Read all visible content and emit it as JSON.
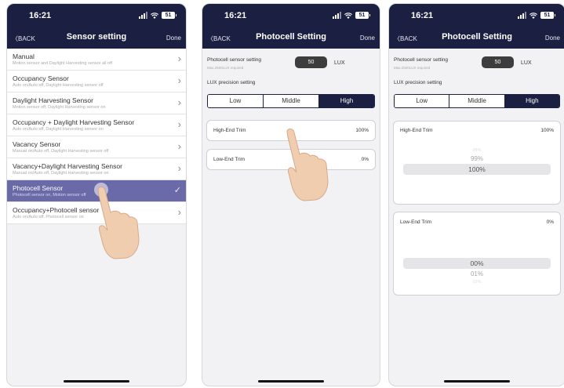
{
  "time": "16:21",
  "battery": "51",
  "screen1": {
    "back": "BACK",
    "title": "Sensor setting",
    "done": "Done",
    "items": [
      {
        "title": "Manual",
        "subtitle": "Motion sensor and Daylight Harvesting sensor all off",
        "selected": false
      },
      {
        "title": "Occupancy Sensor",
        "subtitle": "Auto on/Auto off, Daylight Harvesting sensor off",
        "selected": false
      },
      {
        "title": "Daylight Harvesting Sensor",
        "subtitle": "Motion sensor off,  Daylight Harvesting sensor on",
        "selected": false
      },
      {
        "title": "Occupancy + Daylight Harvesting Sensor",
        "subtitle": "Auto on/Auto off, Daylight Harvesting sensor on",
        "selected": false
      },
      {
        "title": "Vacancy Sensor",
        "subtitle": "Manual on/Auto off, Daylight Harvesting sensor off",
        "selected": false
      },
      {
        "title": "Vacancy+Daylight Harvesting Sensor",
        "subtitle": "Manual on/Auto off, Daylight Harvesting sensor on",
        "selected": false
      },
      {
        "title": "Photocell Sensor",
        "subtitle": "Photocell sensor on, Motion sensor off",
        "selected": true
      },
      {
        "title": "Occupancy+Photocell sensor",
        "subtitle": "Auto on/Auto off, Photocell sensor on",
        "selected": false
      }
    ]
  },
  "screen2": {
    "back": "BACK",
    "title": "Photocell Setting",
    "done": "Done",
    "photocell_label": "Photocell sensor setting",
    "photocell_sub": "Max.2500LUX required",
    "lux_value": "50",
    "lux_unit": "LUX",
    "precision_label": "LUX precision setting",
    "segments": [
      "Low",
      "Middle",
      "High"
    ],
    "active_segment": "High",
    "high_trim_label": "High-End Trim",
    "high_trim_value": "100%",
    "low_trim_label": "Low-End Trim",
    "low_trim_value": "0%"
  },
  "screen3": {
    "back": "BACK",
    "title": "Photocell Setting",
    "done": "Done",
    "photocell_label": "Photocell sensor setting",
    "photocell_sub": "Max.2500LUX required",
    "lux_value": "50",
    "lux_unit": "LUX",
    "precision_label": "LUX precision setting",
    "segments": [
      "Low",
      "Middle",
      "High"
    ],
    "active_segment": "High",
    "high_trim_label": "High-End Trim",
    "high_trim_value": "100%",
    "high_picker": [
      "98%",
      "99%",
      "100%"
    ],
    "low_trim_label": "Low-End Trim",
    "low_trim_value": "0%",
    "low_picker": [
      "00%",
      "01%",
      "02%"
    ]
  },
  "colors": {
    "navbar": "#1b1f42",
    "selected_row": "#6a6aa8"
  },
  "icons": [
    "signal-icon",
    "wifi-icon",
    "battery-icon",
    "back-chevron-icon",
    "chevron-right-icon",
    "checkmark-icon",
    "pointing-hand-icon"
  ]
}
